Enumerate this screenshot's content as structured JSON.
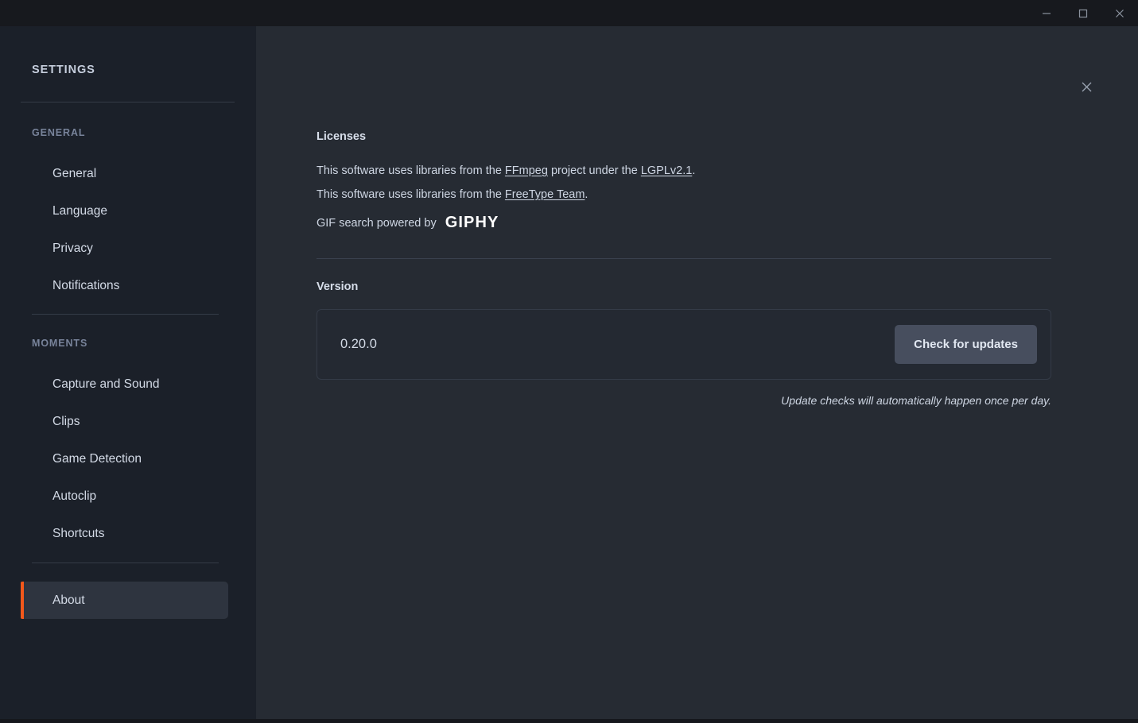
{
  "window": {
    "controls": [
      {
        "name": "minimize",
        "glyph": "minimize-icon"
      },
      {
        "name": "maximize",
        "glyph": "maximize-icon"
      },
      {
        "name": "close",
        "glyph": "close-icon"
      }
    ]
  },
  "sidebar": {
    "title": "SETTINGS",
    "sections": [
      {
        "label": "GENERAL",
        "items": [
          {
            "label": "General",
            "active": false
          },
          {
            "label": "Language",
            "active": false
          },
          {
            "label": "Privacy",
            "active": false
          },
          {
            "label": "Notifications",
            "active": false
          }
        ]
      },
      {
        "label": "MOMENTS",
        "items": [
          {
            "label": "Capture and Sound",
            "active": false
          },
          {
            "label": "Clips",
            "active": false
          },
          {
            "label": "Game Detection",
            "active": false
          },
          {
            "label": "Autoclip",
            "active": false
          },
          {
            "label": "Shortcuts",
            "active": false
          }
        ]
      },
      {
        "label": "",
        "items": [
          {
            "label": "About",
            "active": true
          }
        ]
      }
    ]
  },
  "main": {
    "close_panel_icon": "close-icon",
    "licenses": {
      "heading": "Licenses",
      "line1": {
        "pre": "This software uses libraries from the ",
        "link1": "FFmpeg",
        "mid": " project under the ",
        "link2": "LGPLv2.1",
        "post": "."
      },
      "line2": {
        "pre": "This software uses libraries from the ",
        "link1": "FreeType Team",
        "post": "."
      },
      "giphy_prefix": "GIF search powered by",
      "giphy_logo": "GIPHY"
    },
    "version": {
      "heading": "Version",
      "value": "0.20.0",
      "button_label": "Check for updates",
      "note": "Update checks will automatically happen once per day."
    }
  },
  "colors": {
    "accent": "#f2581b",
    "titlebar_bg": "#17191e",
    "sidebar_bg": "#1b2029",
    "main_bg": "#262b33",
    "card_bg": "#242932",
    "button_bg": "#474e5e"
  }
}
